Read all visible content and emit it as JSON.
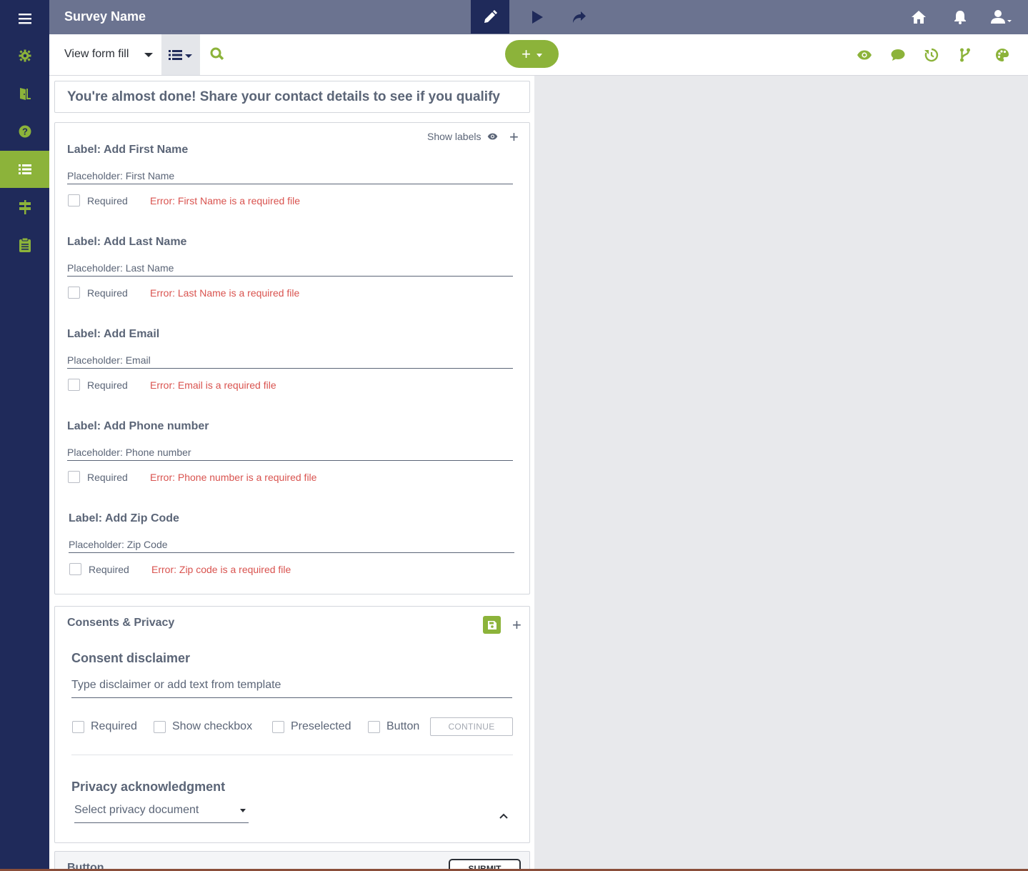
{
  "app": {
    "survey_name": "Survey Name"
  },
  "toolbar": {
    "view_mode": "View form fill",
    "add_label": "+"
  },
  "form": {
    "heading": "You're almost done! Share your contact details to see if you qualify",
    "show_labels": "Show labels",
    "fields": [
      {
        "label": "Label: Add First Name",
        "placeholder": "Placeholder: First Name",
        "required": "Required",
        "error": "Error: First Name is a required file"
      },
      {
        "label": "Label: Add Last Name",
        "placeholder": "Placeholder: Last Name",
        "required": "Required",
        "error": "Error: Last Name is a required file"
      },
      {
        "label": "Label: Add Email",
        "placeholder": "Placeholder: Email",
        "required": "Required",
        "error": "Error: Email is a required file"
      },
      {
        "label": "Label: Add Phone number",
        "placeholder": "Placeholder: Phone number",
        "required": "Required",
        "error": "Error: Phone number is a required file"
      },
      {
        "label": "Label: Add Zip Code",
        "placeholder": "Placeholder: Zip Code",
        "required": "Required",
        "error": "Error: Zip code is a required file"
      }
    ]
  },
  "consents": {
    "title": "Consents & Privacy",
    "disclaimer_title": "Consent disclaimer",
    "disclaimer_placeholder": "Type disclaimer or add text from template",
    "options": [
      "Required",
      "Show checkbox",
      "Preselected",
      "Button"
    ],
    "continue_label": "CONTINUE",
    "privacy_title": "Privacy acknowledgment",
    "privacy_select": "Select privacy document"
  },
  "button_section": {
    "title": "Button",
    "submit_label": "SUBMIT"
  },
  "colors": {
    "sidebar": "#1f2a5a",
    "accent": "#8cb33a",
    "topbar": "#6b7390",
    "error": "#d9534f"
  },
  "icons": {
    "sidebar": [
      "menu-icon",
      "gear-icon",
      "door-icon",
      "help-icon",
      "list-icon",
      "signpost-icon",
      "clipboard-icon"
    ],
    "topbar": [
      "pencil-icon",
      "play-icon",
      "share-icon",
      "home-icon",
      "bell-icon",
      "user-icon"
    ],
    "toolbar_right": [
      "eye-icon",
      "comment-icon",
      "history-icon",
      "branch-icon",
      "palette-icon"
    ]
  }
}
